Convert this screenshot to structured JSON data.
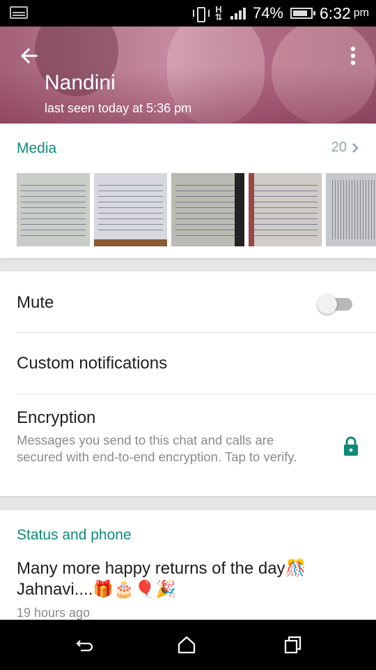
{
  "status_bar": {
    "network": "H",
    "battery": "74%",
    "time": "6:32",
    "time_suffix": "pm"
  },
  "header": {
    "name": "Nandini",
    "last_seen": "last seen today at 5:36 pm"
  },
  "media": {
    "title": "Media",
    "count": "20"
  },
  "settings": {
    "mute_label": "Mute",
    "mute_on": false,
    "custom_notifications_label": "Custom notifications",
    "encryption_label": "Encryption",
    "encryption_desc": "Messages you send to this chat and calls are secured with end-to-end encryption. Tap to verify."
  },
  "status": {
    "title": "Status and phone",
    "text": "Many more happy returns of the day🎊 Jahnavi....🎁🎂🎈🎉",
    "time": "19 hours ago"
  },
  "colors": {
    "accent": "#0f8a78",
    "header_tint": "#b06f88"
  },
  "icons": {
    "back": "arrow-left",
    "menu": "more-vertical",
    "media_more": "chevron-right",
    "encryption": "lock",
    "nav_back": "nav-back",
    "nav_home": "nav-home",
    "nav_recents": "nav-recents"
  }
}
